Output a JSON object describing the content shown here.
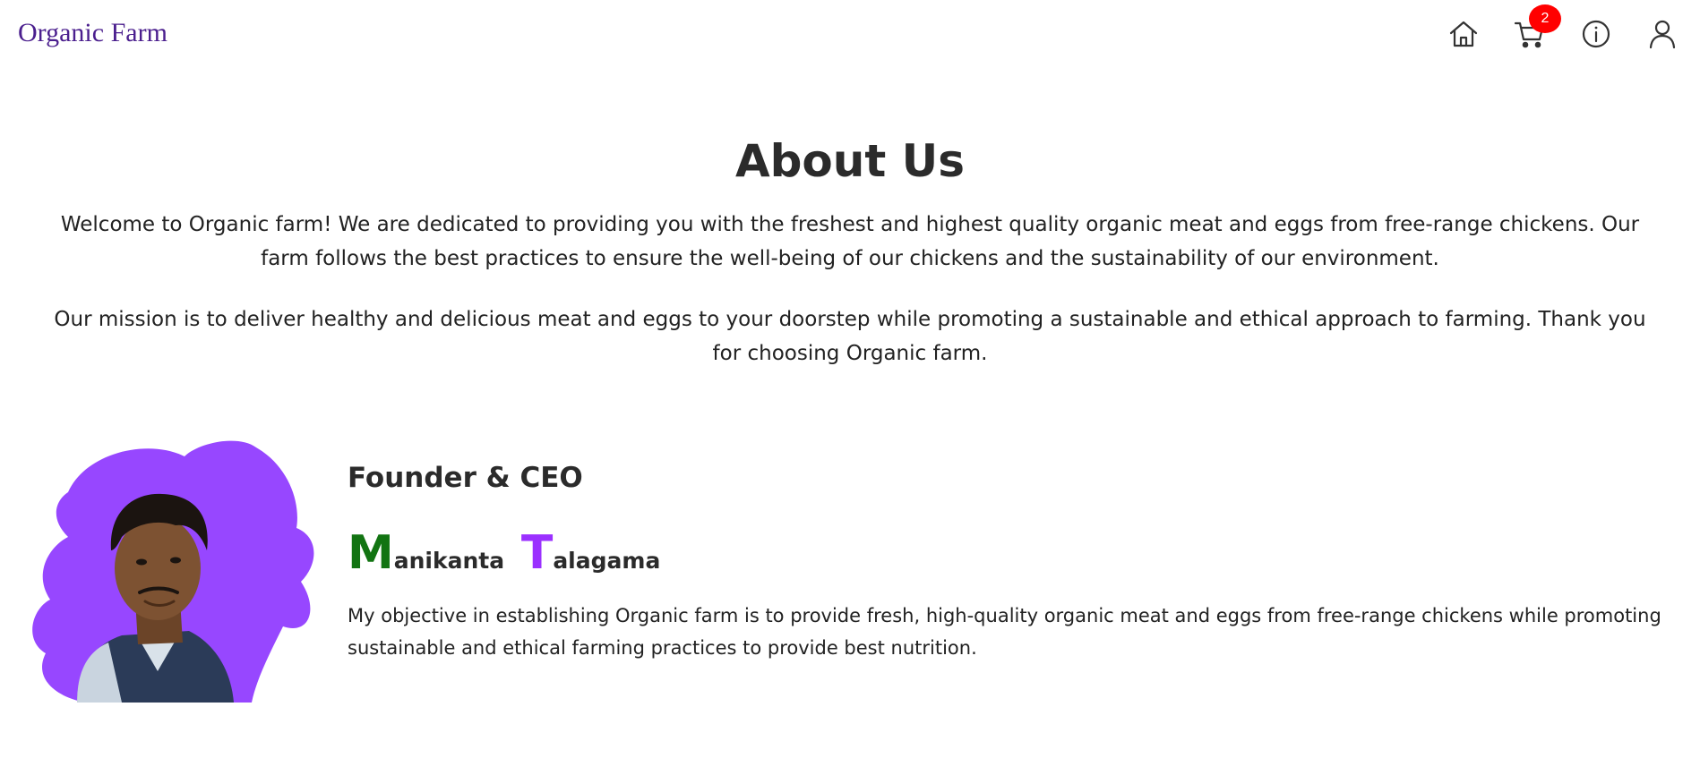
{
  "navbar": {
    "brand": "Organic Farm",
    "icons": {
      "home": "home-icon",
      "cart": "cart-icon",
      "info": "info-icon",
      "user": "user-icon"
    },
    "cart_count": "2"
  },
  "about": {
    "title": "About Us",
    "paragraph1": "Welcome to Organic farm! We are dedicated to providing you with the freshest and highest quality organic meat and eggs from free-range chickens. Our farm follows the best practices to ensure the well-being of our chickens and the sustainability of our environment.",
    "paragraph2": "Our mission is to deliver healthy and delicious meat and eggs to your doorstep while promoting a sustainable and ethical approach to farming. Thank you for choosing Organic farm."
  },
  "founder": {
    "role": "Founder & CEO",
    "first_initial": "M",
    "first_rest": "anikanta",
    "last_initial": "T",
    "last_rest": "alagama",
    "bio": "My objective in establishing Organic farm is to provide fresh, high-quality organic meat and eggs from free-range chickens while promoting sustainable and ethical farming practices to provide best nutrition."
  },
  "colors": {
    "brand": "#4b1f8e",
    "badge": "#ff0000",
    "photo_blob": "#9747ff",
    "name_first_initial": "#127412",
    "name_last_initial": "#9b30ff"
  }
}
